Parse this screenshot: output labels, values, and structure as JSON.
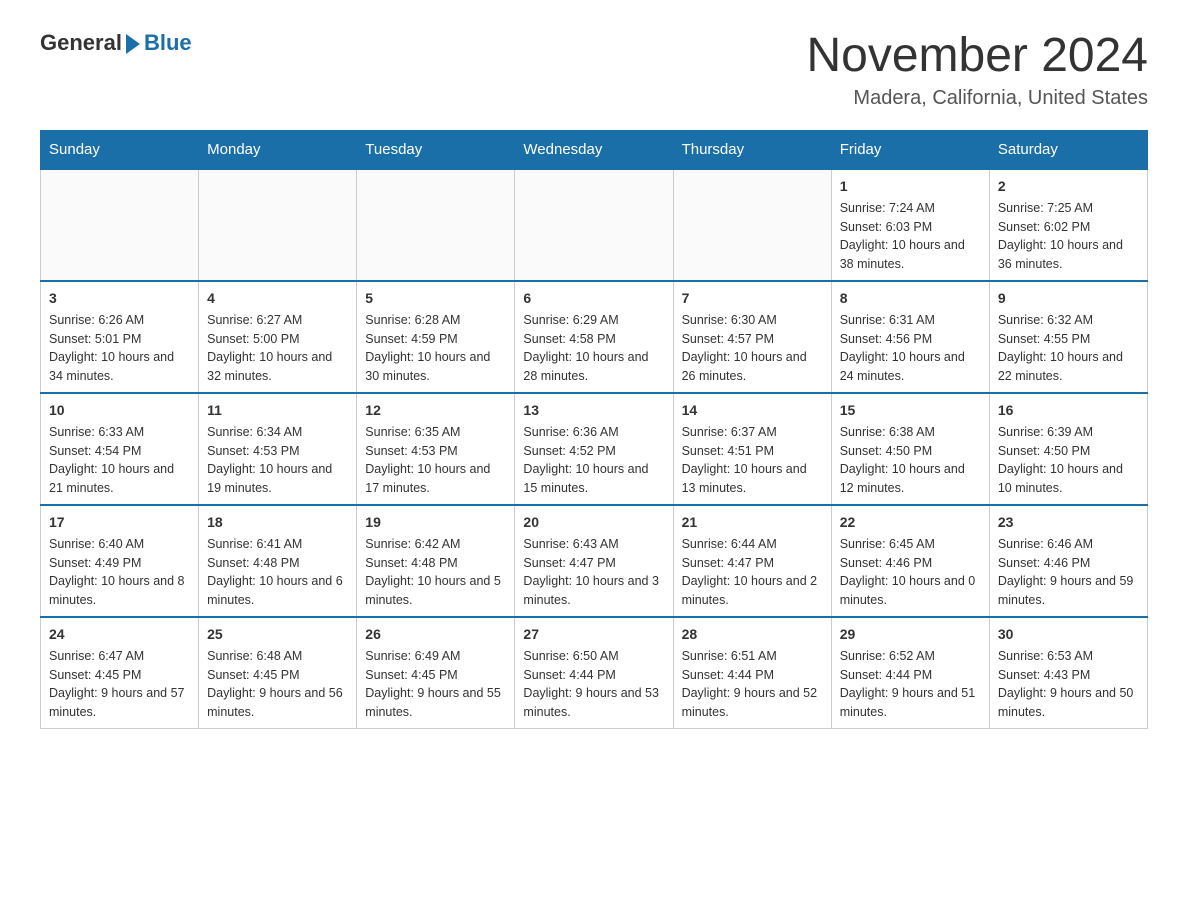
{
  "logo": {
    "general": "General",
    "blue": "Blue"
  },
  "title": "November 2024",
  "subtitle": "Madera, California, United States",
  "days_of_week": [
    "Sunday",
    "Monday",
    "Tuesday",
    "Wednesday",
    "Thursday",
    "Friday",
    "Saturday"
  ],
  "weeks": [
    [
      {
        "day": "",
        "info": ""
      },
      {
        "day": "",
        "info": ""
      },
      {
        "day": "",
        "info": ""
      },
      {
        "day": "",
        "info": ""
      },
      {
        "day": "",
        "info": ""
      },
      {
        "day": "1",
        "info": "Sunrise: 7:24 AM\nSunset: 6:03 PM\nDaylight: 10 hours and 38 minutes."
      },
      {
        "day": "2",
        "info": "Sunrise: 7:25 AM\nSunset: 6:02 PM\nDaylight: 10 hours and 36 minutes."
      }
    ],
    [
      {
        "day": "3",
        "info": "Sunrise: 6:26 AM\nSunset: 5:01 PM\nDaylight: 10 hours and 34 minutes."
      },
      {
        "day": "4",
        "info": "Sunrise: 6:27 AM\nSunset: 5:00 PM\nDaylight: 10 hours and 32 minutes."
      },
      {
        "day": "5",
        "info": "Sunrise: 6:28 AM\nSunset: 4:59 PM\nDaylight: 10 hours and 30 minutes."
      },
      {
        "day": "6",
        "info": "Sunrise: 6:29 AM\nSunset: 4:58 PM\nDaylight: 10 hours and 28 minutes."
      },
      {
        "day": "7",
        "info": "Sunrise: 6:30 AM\nSunset: 4:57 PM\nDaylight: 10 hours and 26 minutes."
      },
      {
        "day": "8",
        "info": "Sunrise: 6:31 AM\nSunset: 4:56 PM\nDaylight: 10 hours and 24 minutes."
      },
      {
        "day": "9",
        "info": "Sunrise: 6:32 AM\nSunset: 4:55 PM\nDaylight: 10 hours and 22 minutes."
      }
    ],
    [
      {
        "day": "10",
        "info": "Sunrise: 6:33 AM\nSunset: 4:54 PM\nDaylight: 10 hours and 21 minutes."
      },
      {
        "day": "11",
        "info": "Sunrise: 6:34 AM\nSunset: 4:53 PM\nDaylight: 10 hours and 19 minutes."
      },
      {
        "day": "12",
        "info": "Sunrise: 6:35 AM\nSunset: 4:53 PM\nDaylight: 10 hours and 17 minutes."
      },
      {
        "day": "13",
        "info": "Sunrise: 6:36 AM\nSunset: 4:52 PM\nDaylight: 10 hours and 15 minutes."
      },
      {
        "day": "14",
        "info": "Sunrise: 6:37 AM\nSunset: 4:51 PM\nDaylight: 10 hours and 13 minutes."
      },
      {
        "day": "15",
        "info": "Sunrise: 6:38 AM\nSunset: 4:50 PM\nDaylight: 10 hours and 12 minutes."
      },
      {
        "day": "16",
        "info": "Sunrise: 6:39 AM\nSunset: 4:50 PM\nDaylight: 10 hours and 10 minutes."
      }
    ],
    [
      {
        "day": "17",
        "info": "Sunrise: 6:40 AM\nSunset: 4:49 PM\nDaylight: 10 hours and 8 minutes."
      },
      {
        "day": "18",
        "info": "Sunrise: 6:41 AM\nSunset: 4:48 PM\nDaylight: 10 hours and 6 minutes."
      },
      {
        "day": "19",
        "info": "Sunrise: 6:42 AM\nSunset: 4:48 PM\nDaylight: 10 hours and 5 minutes."
      },
      {
        "day": "20",
        "info": "Sunrise: 6:43 AM\nSunset: 4:47 PM\nDaylight: 10 hours and 3 minutes."
      },
      {
        "day": "21",
        "info": "Sunrise: 6:44 AM\nSunset: 4:47 PM\nDaylight: 10 hours and 2 minutes."
      },
      {
        "day": "22",
        "info": "Sunrise: 6:45 AM\nSunset: 4:46 PM\nDaylight: 10 hours and 0 minutes."
      },
      {
        "day": "23",
        "info": "Sunrise: 6:46 AM\nSunset: 4:46 PM\nDaylight: 9 hours and 59 minutes."
      }
    ],
    [
      {
        "day": "24",
        "info": "Sunrise: 6:47 AM\nSunset: 4:45 PM\nDaylight: 9 hours and 57 minutes."
      },
      {
        "day": "25",
        "info": "Sunrise: 6:48 AM\nSunset: 4:45 PM\nDaylight: 9 hours and 56 minutes."
      },
      {
        "day": "26",
        "info": "Sunrise: 6:49 AM\nSunset: 4:45 PM\nDaylight: 9 hours and 55 minutes."
      },
      {
        "day": "27",
        "info": "Sunrise: 6:50 AM\nSunset: 4:44 PM\nDaylight: 9 hours and 53 minutes."
      },
      {
        "day": "28",
        "info": "Sunrise: 6:51 AM\nSunset: 4:44 PM\nDaylight: 9 hours and 52 minutes."
      },
      {
        "day": "29",
        "info": "Sunrise: 6:52 AM\nSunset: 4:44 PM\nDaylight: 9 hours and 51 minutes."
      },
      {
        "day": "30",
        "info": "Sunrise: 6:53 AM\nSunset: 4:43 PM\nDaylight: 9 hours and 50 minutes."
      }
    ]
  ]
}
